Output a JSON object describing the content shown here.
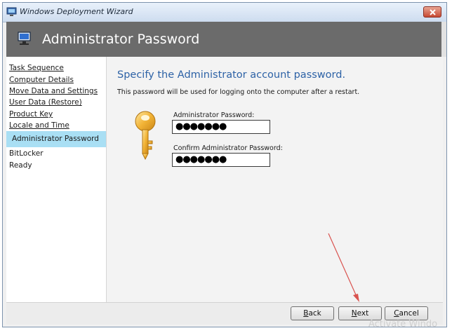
{
  "window": {
    "title": "Windows Deployment Wizard"
  },
  "banner": {
    "title": "Administrator Password"
  },
  "sidebar": {
    "items": [
      {
        "label": "Task Sequence",
        "state": "completed"
      },
      {
        "label": "Computer Details",
        "state": "completed"
      },
      {
        "label": "Move Data and Settings",
        "state": "completed"
      },
      {
        "label": "User Data (Restore)",
        "state": "completed"
      },
      {
        "label": "Product Key",
        "state": "completed"
      },
      {
        "label": "Locale and Time",
        "state": "completed"
      },
      {
        "label": "Administrator Password",
        "state": "active"
      },
      {
        "label": "BitLocker",
        "state": "pending"
      },
      {
        "label": "Ready",
        "state": "pending"
      }
    ]
  },
  "main": {
    "heading": "Specify the Administrator account password.",
    "description": "This password will be used for logging onto the computer after a restart.",
    "password_label": "Administrator Password:",
    "password_value": "●●●●●●●",
    "confirm_label": "Confirm Administrator Password:",
    "confirm_value": "●●●●●●●"
  },
  "footer": {
    "back_access_key": "B",
    "back_rest": "ack",
    "next_access_key": "N",
    "next_rest": "ext",
    "cancel_access_key": "C",
    "cancel_rest": "ancel"
  },
  "watermark": "Activate Windo",
  "colors": {
    "banner": "#6b6b6b",
    "heading": "#2d62a6",
    "active_item": "#a9dff4",
    "arrow": "#d9534f"
  },
  "icons": [
    "wizard-app-icon",
    "close-icon",
    "computer-banner-icon",
    "key-icon"
  ]
}
